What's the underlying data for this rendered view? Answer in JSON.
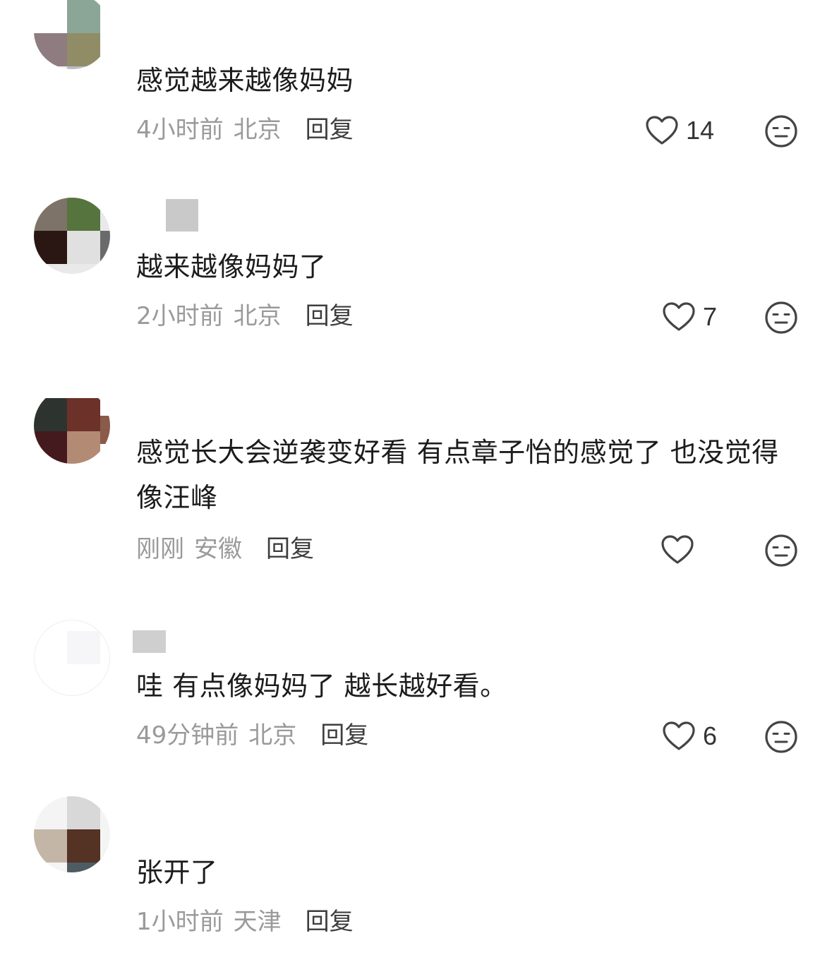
{
  "comments": [
    {
      "text": "感觉越来越像妈妈",
      "time": "4小时前",
      "location": "北京",
      "reply_label": "回复",
      "likes": "14",
      "avatar_colors": [
        "#ffffff",
        "#8ba596",
        "#8e7c80",
        "#908c66",
        "#eeeeee",
        "#b9bcc8"
      ]
    },
    {
      "text": "越来越像妈妈了",
      "time": "2小时前",
      "location": "北京",
      "reply_label": "回复",
      "likes": "7",
      "avatar_colors": [
        "#7e7368",
        "#56743d",
        "#2a1612",
        "#e0e0e0"
      ]
    },
    {
      "text": "感觉长大会逆袭变好看 有点章子怡的感觉了 也没觉得像汪峰",
      "time": "刚刚",
      "location": "安徽",
      "reply_label": "回复",
      "likes": "",
      "avatar_colors": [
        "#2d3430",
        "#6c3129",
        "#451a1e",
        "#b38a74"
      ]
    },
    {
      "text": "哇 有点像妈妈了 越长越好看。",
      "time": "49分钟前",
      "location": "北京",
      "reply_label": "回复",
      "likes": "6",
      "avatar_colors": [
        "#ffffff",
        "#f6f6f8",
        "#ffffff",
        "#ffffff"
      ]
    },
    {
      "text": "张开了",
      "time": "1小时前",
      "location": "天津",
      "reply_label": "回复",
      "likes": "",
      "avatar_colors": [
        "#ffffff",
        "#d8d8d8",
        "#c3b6a6",
        "#543224",
        "#ffffff",
        "#4d5c63"
      ]
    }
  ],
  "icons": {
    "like": "heart-outline-icon",
    "dislike": "meh-face-icon"
  },
  "colors": {
    "text": "#1c1c1c",
    "meta": "#9a9a9a",
    "reply": "#3d3d3d",
    "icon": "#444444"
  }
}
